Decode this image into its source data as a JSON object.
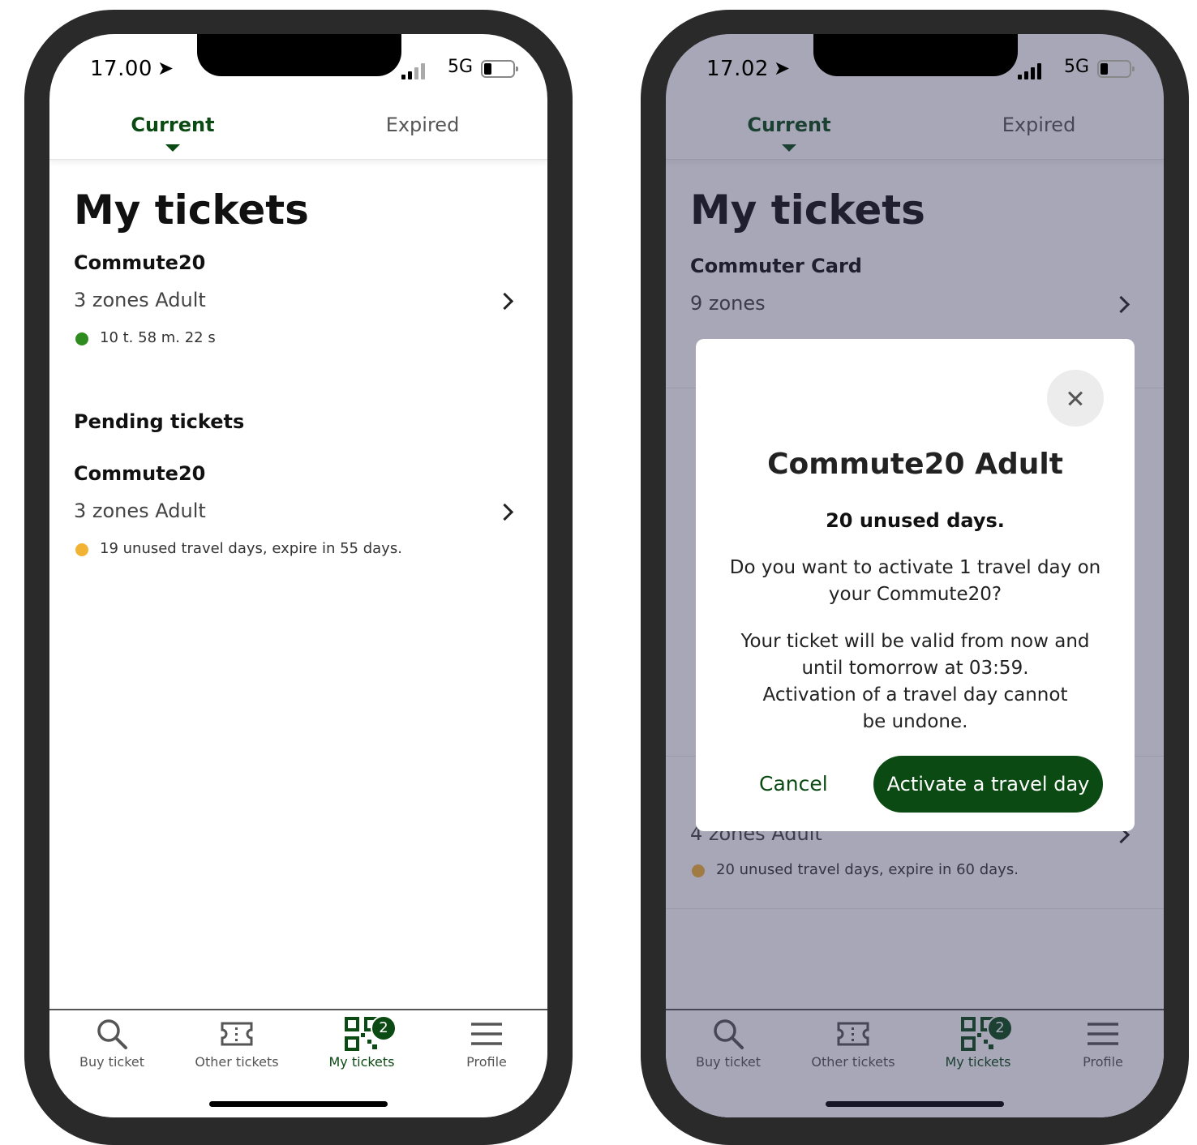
{
  "left_screen": {
    "status": {
      "time": "17.00",
      "network": "5G"
    },
    "tabs": {
      "current": "Current",
      "expired": "Expired"
    },
    "heading": "My tickets",
    "active_ticket": {
      "title": "Commute20",
      "subtitle": "3 zones Adult",
      "timer": "10 t. 58 m. 22 s"
    },
    "pending_heading": "Pending tickets",
    "pending_ticket": {
      "title": "Commute20",
      "subtitle": "3 zones Adult",
      "status": "19 unused travel days, expire in 55 days."
    },
    "nav": {
      "buy": "Buy ticket",
      "other": "Other tickets",
      "my": "My tickets",
      "profile": "Profile",
      "badge": "2"
    }
  },
  "right_screen": {
    "status": {
      "time": "17.02",
      "network": "5G"
    },
    "tabs": {
      "current": "Current",
      "expired": "Expired"
    },
    "heading": "My tickets",
    "card_ticket": {
      "title": "Commuter Card",
      "subtitle": "9 zones"
    },
    "lower_ticket": {
      "subtitle": "4 zones Adult",
      "status": "20 unused travel days, expire in 60 days."
    },
    "modal": {
      "title": "Commute20  Adult",
      "unused": "20 unused days.",
      "question_line1": "Do you want to activate 1 travel day on",
      "question_line2": "your Commute20?",
      "info_line1": "Your ticket will be valid from now and",
      "info_line2": "until tomorrow at 03:59.",
      "info_line3": "Activation of a travel day cannot",
      "info_line4": "be undone.",
      "cancel": "Cancel",
      "activate": "Activate a travel day"
    },
    "nav": {
      "buy": "Buy ticket",
      "other": "Other tickets",
      "my": "My tickets",
      "profile": "Profile",
      "badge": "2"
    }
  },
  "colors": {
    "brand_green": "#0b4a12",
    "active_dot": "#2e8b1e",
    "pending_dot": "#f2b233",
    "overlay": "#9a9aa6"
  }
}
